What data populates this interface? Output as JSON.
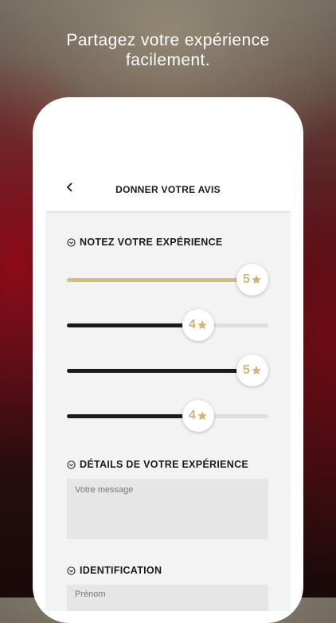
{
  "headline": {
    "line1": "Partagez votre expérience",
    "line2": "facilement."
  },
  "appbar": {
    "title": "DONNER VOTRE AVIS"
  },
  "rating_section": {
    "title": "NOTEZ VOTRE EXPÉRIENCE",
    "ratings": [
      {
        "value": 5,
        "max": 5,
        "label": "5",
        "color": "#d4bd82"
      },
      {
        "value": 4,
        "max": 5,
        "label": "4",
        "color": "#1a1a1a"
      },
      {
        "value": 5,
        "max": 5,
        "label": "5",
        "color": "#1a1a1a"
      },
      {
        "value": 4,
        "max": 5,
        "label": "4",
        "color": "#1a1a1a"
      }
    ]
  },
  "details_section": {
    "title": "DÉTAILS DE VOTRE EXPÉRIENCE",
    "message_placeholder": "Votre message"
  },
  "identification_section": {
    "title": "IDENTIFICATION",
    "firstname_placeholder": "Prénom"
  },
  "colors": {
    "gold": "#d0b678",
    "dark": "#1a1a1a",
    "track": "#dedede"
  },
  "icons": {
    "back": "chevron-left-icon",
    "section": "chevron-down-circle-icon",
    "star": "star-icon"
  }
}
